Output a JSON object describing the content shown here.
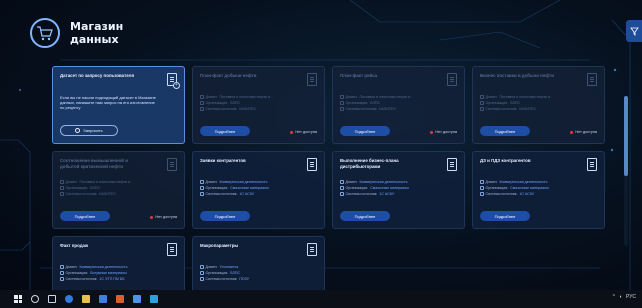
{
  "header": {
    "title": "Магазин данных",
    "logo_icon": "cart-database-icon"
  },
  "toolbar": {
    "filter_icon": "filter-icon"
  },
  "labels": {
    "domain": "Домен:",
    "org": "Организация:",
    "source": "Системы источник:",
    "more": "Подробнее",
    "no_access": "Нет доступа"
  },
  "request_card": {
    "title": "Датасет по запросу пользователя",
    "description": "Если вы не нашли подходящий датасет в Магазине данных, напишите нам запрос на его изготовление по рецепту",
    "button": "Запросить"
  },
  "cards": [
    {
      "title": "План-факт добычи нефти",
      "domain": "Поставка и логистика нефти и...",
      "org": "БЛПС",
      "source": "КАЛИТЕХ",
      "access": false
    },
    {
      "title": "План-факт рейса",
      "domain": "Поставка и логистика нефти и...",
      "org": "БЛПС",
      "source": "КАЛИТЕХ",
      "access": false
    },
    {
      "title": "Бизнес поставки и добычи нефти",
      "domain": "Поставка и логистика нефти и...",
      "org": "БЛПС",
      "source": "КАЛИТЕХ",
      "access": false
    },
    {
      "title": "Соотношение вымышленной и добытой критической нефти",
      "domain": "Поставка и логистика нефти и...",
      "org": "БЛПС",
      "source": "КАЛИТЕХ",
      "access": false
    },
    {
      "title": "Заявки контрагентов",
      "domain": "Коммерческая деятельность",
      "org": "Смазочные материалы",
      "source": "1С АСКУ",
      "access": true
    },
    {
      "title": "Выполнение бизнес-плана дистрибьюторами",
      "domain": "Коммерческая деятельность",
      "org": "Смазочные материалы",
      "source": "1С АСКУ",
      "access": true
    },
    {
      "title": "ДЗ и ПДЗ контрагентов",
      "domain": "Коммерческая деятельность",
      "org": "Смазочные материалы",
      "source": "1С АСКУ",
      "access": true
    },
    {
      "title": "Факт продаж",
      "domain": "Коммерческая деятельность",
      "org": "Битумные материалы",
      "source": "1С ЭТП ПМ ББ",
      "access": true
    },
    {
      "title": "Макропараметры",
      "domain": "Уточняется",
      "org": "БЛПС",
      "source": "ПОЗУ",
      "access": true
    }
  ],
  "taskbar": {
    "tray_text": "РУС"
  },
  "colors": {
    "accent": "#1e4da6",
    "no_access_dot": "#e03a3a",
    "link": "#6fa4ff"
  }
}
